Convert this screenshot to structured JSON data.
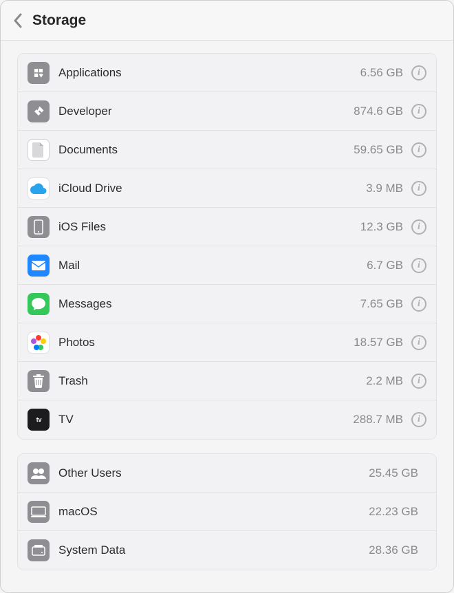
{
  "header": {
    "title": "Storage"
  },
  "groups": [
    {
      "items": [
        {
          "icon": "applications-icon",
          "name": "Applications",
          "size": "6.56 GB",
          "info": true
        },
        {
          "icon": "developer-icon",
          "name": "Developer",
          "size": "874.6 GB",
          "info": true
        },
        {
          "icon": "documents-icon",
          "name": "Documents",
          "size": "59.65 GB",
          "info": true
        },
        {
          "icon": "icloud-icon",
          "name": "iCloud Drive",
          "size": "3.9 MB",
          "info": true
        },
        {
          "icon": "ios-files-icon",
          "name": "iOS Files",
          "size": "12.3 GB",
          "info": true
        },
        {
          "icon": "mail-icon",
          "name": "Mail",
          "size": "6.7 GB",
          "info": true
        },
        {
          "icon": "messages-icon",
          "name": "Messages",
          "size": "7.65 GB",
          "info": true
        },
        {
          "icon": "photos-icon",
          "name": "Photos",
          "size": "18.57 GB",
          "info": true
        },
        {
          "icon": "trash-icon",
          "name": "Trash",
          "size": "2.2 MB",
          "info": true
        },
        {
          "icon": "tv-icon",
          "name": "TV",
          "size": "288.7 MB",
          "info": true
        }
      ]
    },
    {
      "items": [
        {
          "icon": "other-users-icon",
          "name": "Other Users",
          "size": "25.45 GB",
          "info": false
        },
        {
          "icon": "macos-icon",
          "name": "macOS",
          "size": "22.23 GB",
          "info": false
        },
        {
          "icon": "system-data-icon",
          "name": "System Data",
          "size": "28.36 GB",
          "info": false
        }
      ]
    }
  ]
}
